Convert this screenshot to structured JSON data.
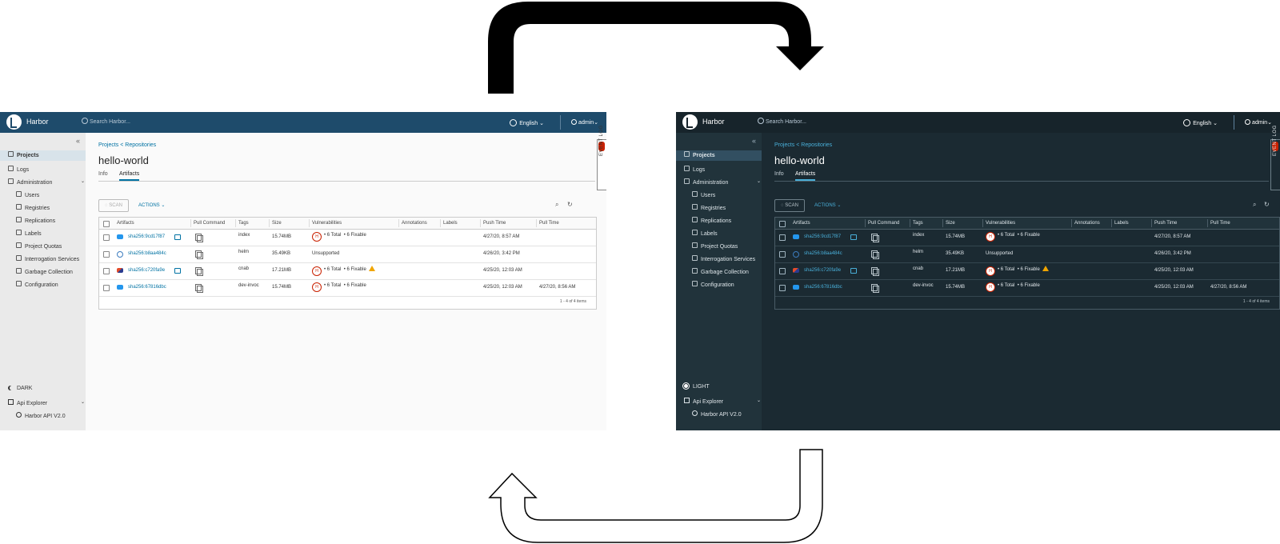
{
  "brand": "Harbor",
  "search_placeholder": "Search Harbor...",
  "language": "English",
  "user": "admin",
  "breadcrumb": "Projects  < Repositories",
  "repo_title": "hello-world",
  "tabs": [
    "Info",
    "Artifacts"
  ],
  "event_log": "EVENT LOG",
  "scan_label": "SCAN",
  "actions_label": "ACTIONS",
  "sidebar": {
    "projects": "Projects",
    "logs": "Logs",
    "administration": "Administration",
    "admin_items": [
      "Users",
      "Registries",
      "Replications",
      "Labels",
      "Project Quotas",
      "Interrogation Services",
      "Garbage Collection",
      "Configuration"
    ],
    "api_explorer": "Api Explorer",
    "harbor_api": "Harbor API V2.0"
  },
  "theme_toggle": {
    "light_panel": "DARK",
    "dark_panel": "LIGHT"
  },
  "columns": [
    "Artifacts",
    "Pull Command",
    "Tags",
    "Size",
    "Vulnerabilities",
    "Annotations",
    "Labels",
    "Push Time",
    "Pull Time"
  ],
  "rows": [
    {
      "digest": "sha256:9cd17f87",
      "tag": "index",
      "size": "15.74MB",
      "vuln_total": "6 Total",
      "vuln_fix": "6 Fixable",
      "push": "4/27/20, 8:57 AM",
      "pull": ""
    },
    {
      "digest": "sha256:b8aa484c",
      "tag": "helm",
      "size": "35.49KB",
      "vuln_text": "Unsupported",
      "push": "4/26/20, 3:42 PM",
      "pull": ""
    },
    {
      "digest": "sha256:c720fa9e",
      "tag": "cnab",
      "size": "17.21MB",
      "vuln_total": "6 Total",
      "vuln_fix": "6 Fixable",
      "push": "4/25/20, 12:03 AM",
      "pull": ""
    },
    {
      "digest": "sha256:67816dbc",
      "tag": "dev-invoc",
      "size": "15.74MB",
      "vuln_total": "6 Total",
      "vuln_fix": "6 Fixable",
      "push": "4/25/20, 12:03 AM",
      "pull": "4/27/20, 8:56 AM"
    }
  ],
  "footer": "1 - 4 of 4 items",
  "severity_letter": "H",
  "colors": {
    "header_light": "#1e4b6b",
    "header_dark": "#17242b",
    "panel_dark": "#1b2a32",
    "link": "#0072a3",
    "critical": "#c92100"
  }
}
